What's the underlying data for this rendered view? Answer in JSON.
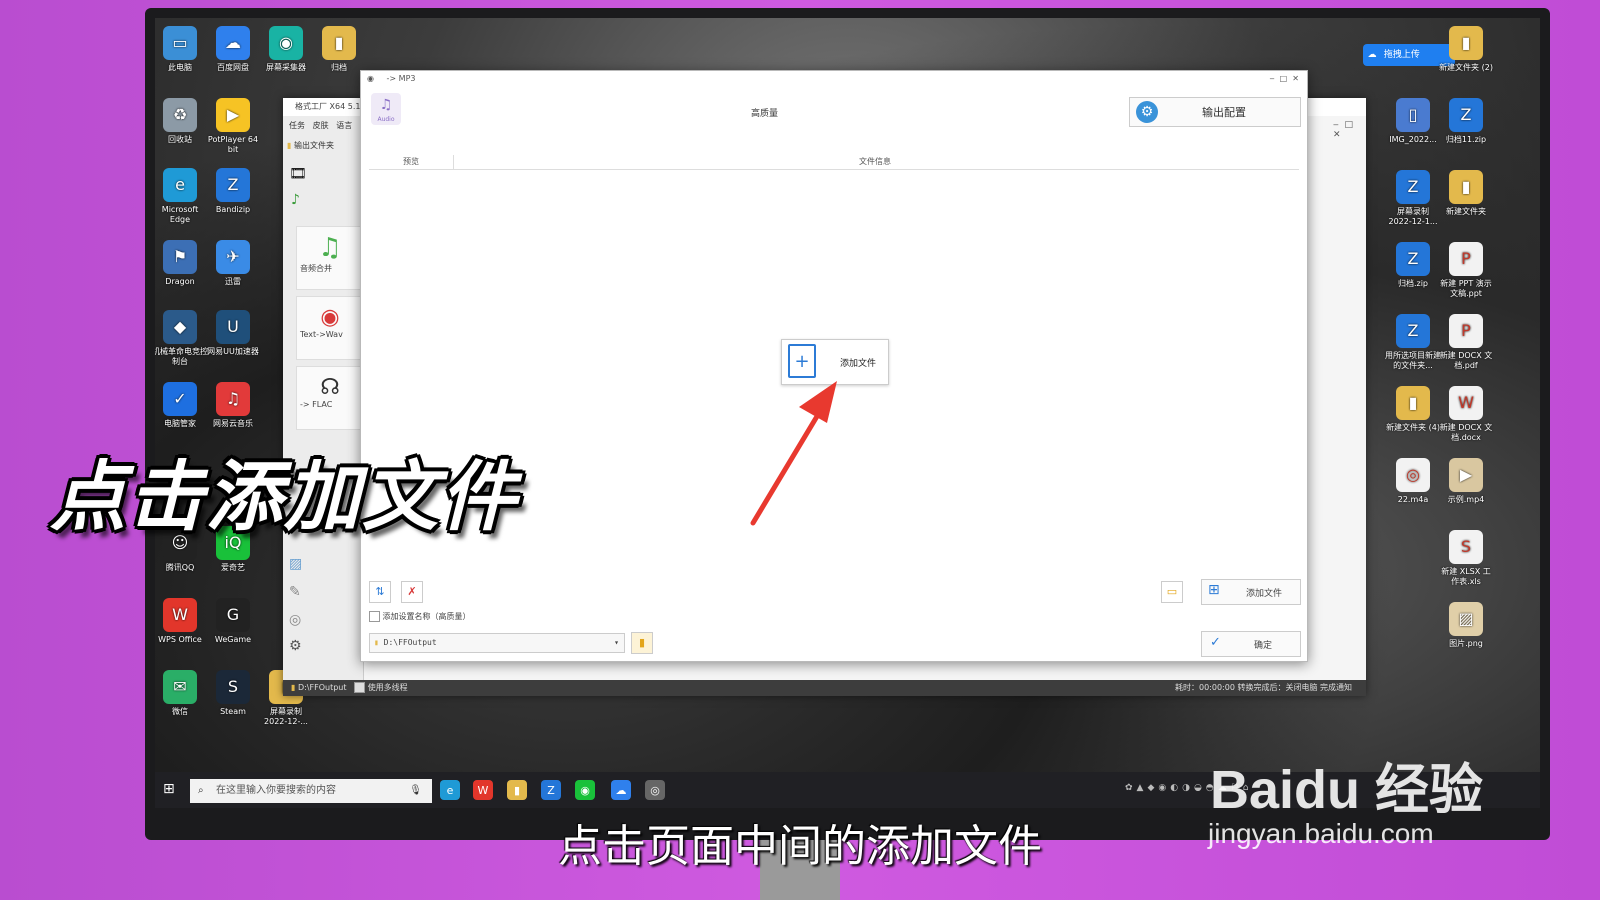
{
  "desktop_left": [
    {
      "label": "此电脑",
      "icon": "pc-icon",
      "color": "#3b8fd6",
      "glyph": "▭"
    },
    {
      "label": "百度网盘",
      "icon": "cloud-icon",
      "color": "#2f80ed",
      "glyph": "☁"
    },
    {
      "label": "屏幕采集器",
      "icon": "capture-icon",
      "color": "#19b3a4",
      "glyph": "◉"
    },
    {
      "label": "归档",
      "icon": "folder-icon",
      "color": "#e3b94c",
      "glyph": "▮"
    },
    {
      "label": "回收站",
      "icon": "recycle-bin-icon",
      "color": "#8c9aa6",
      "glyph": "♻"
    },
    {
      "label": "PotPlayer 64 bit",
      "icon": "potplayer-icon",
      "color": "#f6c324",
      "glyph": "▶"
    },
    {
      "label": "Microsoft Edge",
      "icon": "edge-icon",
      "color": "#1f9ad6",
      "glyph": "e"
    },
    {
      "label": "Bandizip",
      "icon": "bandizip-icon",
      "color": "#2476d8",
      "glyph": "Z"
    },
    {
      "label": "Dragon",
      "icon": "dragon-icon",
      "color": "#3c6fb5",
      "glyph": "⚑"
    },
    {
      "label": "迅雷",
      "icon": "thunder-icon",
      "color": "#3a8be6",
      "glyph": "✈"
    },
    {
      "label": "机械革命电竞控制台",
      "icon": "console-icon",
      "color": "#2b5a8a",
      "glyph": "◆"
    },
    {
      "label": "网易UU加速器",
      "icon": "uu-icon",
      "color": "#1f4f7a",
      "glyph": "U"
    },
    {
      "label": "电脑管家",
      "icon": "shield-icon",
      "color": "#1e6fe0",
      "glyph": "✓"
    },
    {
      "label": "网易云音乐",
      "icon": "music-icon",
      "color": "#e23a3a",
      "glyph": "♫"
    },
    {
      "label": "腾讯QQ",
      "icon": "qq-icon",
      "color": "#222",
      "glyph": "☺"
    },
    {
      "label": "爱奇艺",
      "icon": "iqiyi-icon",
      "color": "#19c13a",
      "glyph": "iQ"
    },
    {
      "label": "WPS Office",
      "icon": "wps-icon",
      "color": "#e2362b",
      "glyph": "W"
    },
    {
      "label": "WeGame",
      "icon": "wegame-icon",
      "color": "#222",
      "glyph": "G"
    },
    {
      "label": "微信",
      "icon": "wechat-icon",
      "color": "#2aae67",
      "glyph": "✉"
    },
    {
      "label": "Steam",
      "icon": "steam-icon",
      "color": "#1b2838",
      "glyph": "S"
    },
    {
      "label": "屏幕录制 2022-12-...",
      "icon": "folder-icon",
      "color": "#e3b94c",
      "glyph": "▮"
    }
  ],
  "desktop_right": [
    {
      "label": "新建文件夹 (2)",
      "icon": "folder-icon",
      "color": "#e3b94c",
      "glyph": "▮"
    },
    {
      "label": "IMG_2022...",
      "icon": "phone-image-icon",
      "color": "#4a7bd0",
      "glyph": "▯"
    },
    {
      "label": "归档11.zip",
      "icon": "zip-icon",
      "color": "#2476d8",
      "glyph": "Z"
    },
    {
      "label": "屏幕录制 2022-12-1...",
      "icon": "zip-icon",
      "color": "#2476d8",
      "glyph": "Z"
    },
    {
      "label": "新建文件夹",
      "icon": "folder-icon",
      "color": "#e3b94c",
      "glyph": "▮"
    },
    {
      "label": "归档.zip",
      "icon": "zip-icon",
      "color": "#2476d8",
      "glyph": "Z"
    },
    {
      "label": "新建 PPT 演示文稿.ppt",
      "icon": "ppt-icon",
      "color": "#f2f2f2",
      "glyph": "P"
    },
    {
      "label": "用所选项目新建的文件夹...",
      "icon": "zip-icon",
      "color": "#2476d8",
      "glyph": "Z"
    },
    {
      "label": "新建 DOCX 文档.pdf",
      "icon": "pdf-icon",
      "color": "#f2f2f2",
      "glyph": "P"
    },
    {
      "label": "新建文件夹 (4)",
      "icon": "folder-icon",
      "color": "#e3b94c",
      "glyph": "▮"
    },
    {
      "label": "新建 DOCX 文档.docx",
      "icon": "docx-icon",
      "color": "#f2f2f2",
      "glyph": "W"
    },
    {
      "label": "22.m4a",
      "icon": "audio-file-icon",
      "color": "#f2f2f2",
      "glyph": "◎"
    },
    {
      "label": "示例.mp4",
      "icon": "video-file-icon",
      "color": "#d9c7a0",
      "glyph": "▶"
    },
    {
      "label": "新建 XLSX 工作表.xls",
      "icon": "xlsx-icon",
      "color": "#f2f2f2",
      "glyph": "S"
    },
    {
      "label": "图片.png",
      "icon": "image-file-icon",
      "color": "#e0cfa8",
      "glyph": "▨"
    }
  ],
  "upload_badge": "拖拽上传",
  "bg_window": {
    "title": "格式工厂 X64 5.13",
    "menu": [
      "任务",
      "皮肤",
      "语言"
    ],
    "output_folder": "输出文件夹",
    "tiles": [
      "音频合并",
      "Text->Wav",
      "-> FLAC"
    ],
    "status_path": "D:\\FFOutput",
    "status_multithread": "使用多线程",
    "status_right": "耗时：00:00:00  转换完成后：关闭电脑  完成通知"
  },
  "dialog": {
    "title": "-> MP3",
    "audio_label": "Audio",
    "quality": "高质量",
    "output_config": "输出配置",
    "col_preview": "预览",
    "col_fileinfo": "文件信息",
    "add_file_center": "添加文件",
    "add_file": "添加文件",
    "add_setting_name": "添加设置名称（高质量）",
    "output_path": "D:\\FFOutput",
    "ok": "确定"
  },
  "taskbar": {
    "search_placeholder": "在这里输入你要搜索的内容"
  },
  "captions": {
    "big": "点击添加文件",
    "subtitle": "点击页面中间的添加文件",
    "watermark_brand": "Baidu 经验",
    "watermark_url": "jingyan.baidu.com"
  },
  "colors": {
    "accent_red_arrow": "#e8392f",
    "gear_blue": "#3a93d9",
    "background_purple": "#c452d6"
  }
}
